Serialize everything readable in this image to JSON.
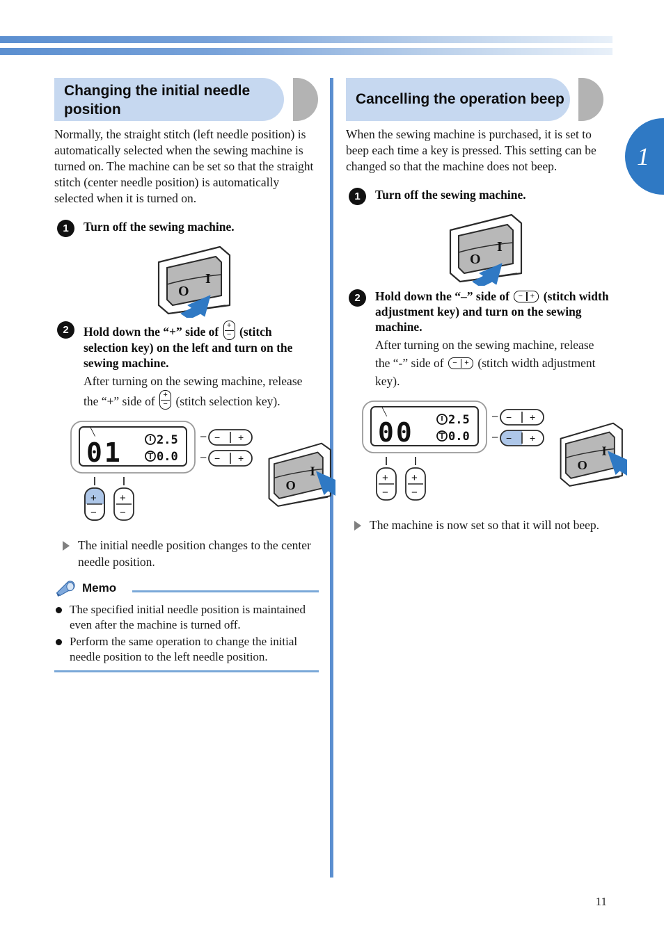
{
  "page": {
    "number": "11",
    "side_tab_number": "1",
    "accent_blue": "#2f79c4",
    "header_band_blue": "#5b8fd0",
    "section_plate_blue": "#c6d8f0",
    "highlight_blue": "#adc6e8"
  },
  "left_column": {
    "section_title": "Changing the initial needle position",
    "intro": "Normally, the straight stitch (left needle position) is automatically selected when the sewing machine is turned on. The machine can be set so that the straight stitch (center needle position) is automatically selected when it is turned on.",
    "steps": [
      {
        "badge": "1",
        "title": "Turn off the sewing machine.",
        "illustration": "power-switch-off"
      },
      {
        "badge": "2",
        "title_part1": "Hold down the “+” side of",
        "title_icon": "stitch-selection-key-vertical",
        "title_part2": "(stitch selection key) on the left and turn on the sewing machine.",
        "sub_part1": "After turning on the sewing machine, release the “+” side of",
        "sub_icon": "stitch-selection-key-vertical",
        "sub_part2": "(stitch selection key)."
      }
    ],
    "diagram": {
      "lcd_pattern": "01",
      "lcd_width_value": "2.5",
      "lcd_length_value": "0.0",
      "width_icon": "stitch-width-icon",
      "length_icon": "stitch-length-icon",
      "dash_marks": [
        "–",
        "–"
      ],
      "side_keys": [
        {
          "minus": "−",
          "plus": "+",
          "highlight": "none"
        },
        {
          "minus": "−",
          "plus": "+",
          "highlight": "none"
        }
      ],
      "bottom_keys": [
        {
          "plus": "+",
          "minus": "−",
          "highlight": "plus"
        },
        {
          "plus": "+",
          "minus": "−",
          "highlight": "none"
        }
      ],
      "switch_label_off": "O",
      "switch_label_on": "I",
      "switch_state": "on-pressed"
    },
    "result": "The initial needle position changes to the center needle position.",
    "memo": {
      "title": "Memo",
      "items": [
        "The specified initial needle position is maintained even after the machine is turned off.",
        "Perform the same operation to change the initial needle position to the left needle position."
      ]
    }
  },
  "right_column": {
    "section_title": "Cancelling the operation beep",
    "intro": "When the sewing machine is purchased, it is set to beep each time a key is pressed. This setting can be changed so that the machine does not beep.",
    "steps": [
      {
        "badge": "1",
        "title": "Turn off the sewing machine.",
        "illustration": "power-switch-off"
      },
      {
        "badge": "2",
        "title_part1": "Hold down the “–” side of",
        "title_icon": "stitch-width-adjustment-key-horizontal",
        "title_part2": "(stitch width adjustment key) and turn on the sewing machine.",
        "sub_part1": "After turning on the sewing machine, release the “-” side of",
        "sub_icon": "stitch-width-adjustment-key-horizontal",
        "sub_part2": "(stitch width adjustment key)."
      }
    ],
    "diagram": {
      "lcd_pattern": "00",
      "lcd_width_value": "2.5",
      "lcd_length_value": "0.0",
      "width_icon": "stitch-width-icon",
      "length_icon": "stitch-length-icon",
      "dash_marks": [
        "–",
        "–"
      ],
      "side_keys": [
        {
          "minus": "−",
          "plus": "+",
          "highlight": "none"
        },
        {
          "minus": "−",
          "plus": "+",
          "highlight": "minus"
        }
      ],
      "bottom_keys": [
        {
          "plus": "+",
          "minus": "−",
          "highlight": "none"
        },
        {
          "plus": "+",
          "minus": "−",
          "highlight": "none"
        }
      ],
      "switch_label_off": "O",
      "switch_label_on": "I",
      "switch_state": "on-pressed"
    },
    "result": "The machine is now set so that it will not beep."
  }
}
